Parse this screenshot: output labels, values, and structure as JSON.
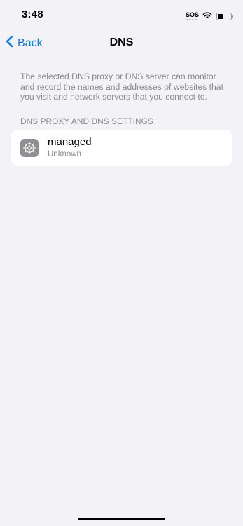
{
  "status_bar": {
    "time": "3:48",
    "sos": "SOS",
    "battery_level": 0.45
  },
  "nav": {
    "back_label": "Back",
    "title": "DNS"
  },
  "content": {
    "description": "The selected DNS proxy or DNS server can monitor and record the names and addresses of websites that you visit and network servers that you connect to.",
    "section_header": "DNS PROXY AND DNS SETTINGS",
    "items": [
      {
        "title": "managed",
        "subtitle": "Unknown",
        "icon": "gear-icon"
      }
    ]
  },
  "colors": {
    "background": "#f2f2f7",
    "accent": "#007aff",
    "secondary_text": "#8a8a8e",
    "icon_background": "#8e8e93"
  }
}
